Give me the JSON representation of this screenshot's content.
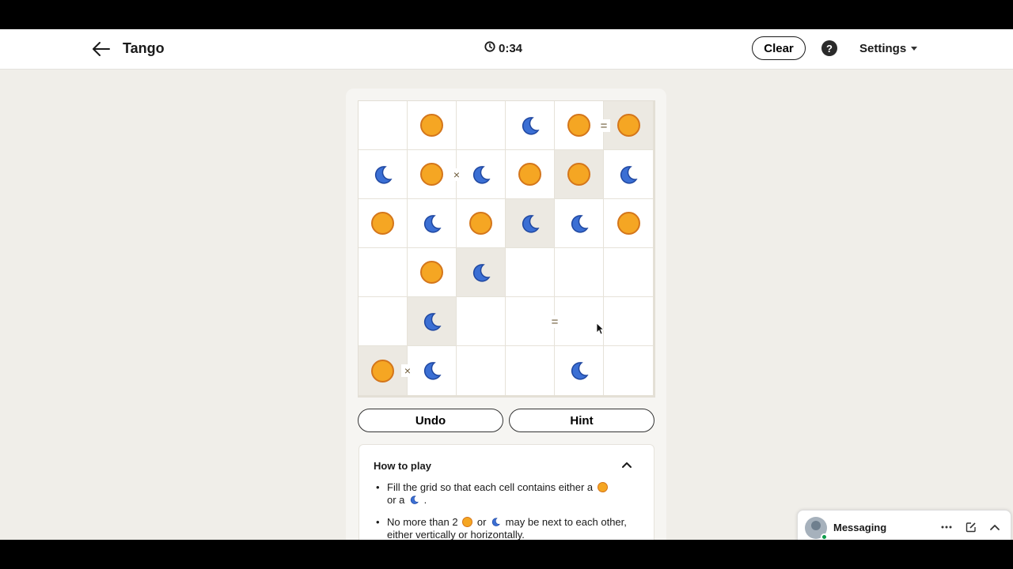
{
  "header": {
    "title": "Tango",
    "timer": "0:34",
    "clear_label": "Clear",
    "help_label": "?",
    "settings_label": "Settings"
  },
  "board": {
    "size": 6,
    "cells": [
      [
        "",
        "sun",
        "",
        "moon",
        "sun",
        "sun"
      ],
      [
        "moon",
        "sun",
        "moon",
        "sun",
        "sun",
        "moon"
      ],
      [
        "sun",
        "moon",
        "sun",
        "moon",
        "moon",
        "sun"
      ],
      [
        "",
        "sun",
        "moon",
        "",
        "",
        ""
      ],
      [
        "",
        "moon",
        "",
        "",
        "",
        ""
      ],
      [
        "sun",
        "moon",
        "",
        "",
        "moon",
        ""
      ]
    ],
    "locked": [
      [
        0,
        5
      ],
      [
        1,
        4
      ],
      [
        2,
        3
      ],
      [
        3,
        2
      ],
      [
        4,
        1
      ],
      [
        5,
        0
      ]
    ],
    "constraints": [
      {
        "between": [
          [
            0,
            4
          ],
          [
            0,
            5
          ]
        ],
        "symbol": "="
      },
      {
        "between": [
          [
            1,
            1
          ],
          [
            1,
            2
          ]
        ],
        "symbol": "×"
      },
      {
        "between": [
          [
            4,
            3
          ],
          [
            4,
            4
          ]
        ],
        "symbol": "="
      },
      {
        "between": [
          [
            5,
            0
          ],
          [
            5,
            1
          ]
        ],
        "symbol": "×"
      }
    ]
  },
  "actions": {
    "undo_label": "Undo",
    "hint_label": "Hint"
  },
  "how_to_play": {
    "title": "How to play",
    "rule1_a": "Fill the grid so that each cell contains either a",
    "rule1_b": "or a",
    "rule1_c": ".",
    "rule2_a": "No more than 2",
    "rule2_b": "or",
    "rule2_c": "may be next to each other, either vertically or horizontally."
  },
  "messaging": {
    "label": "Messaging"
  },
  "colors": {
    "sun": "#f5a623",
    "sun_border": "#d4761b",
    "moon": "#3b6fd4",
    "locked_cell": "#ece9e2",
    "background": "#f0eee9"
  }
}
